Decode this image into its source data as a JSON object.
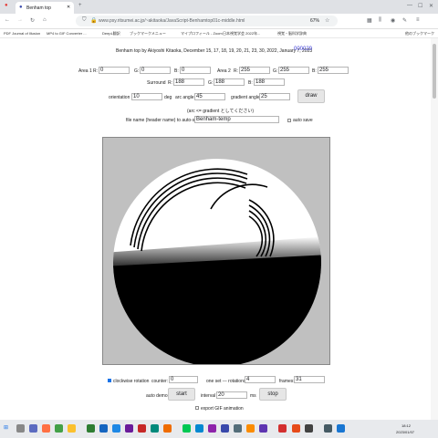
{
  "browser": {
    "tab_title": "Benham top",
    "url": "www.psy.ritsumei.ac.jp/~akitaoka/JavaScript-Benhamtop01c-middle.html",
    "zoom": "67%",
    "bookmarks": [
      "PDF Journal of Illusion",
      "MP4 to GIF Converter ...",
      "DeepL翻訳",
      "ブックマークメニュー",
      "マイプロフィール - Zoom",
      "日本視覚学会 2022年...",
      "視覚・脳科学辞典",
      "他のブックマーク"
    ]
  },
  "page": {
    "header": "Benham top by Akiyoshi Kitaoka, December 15, 17, 18, 19, 20, 21, 23, 30, 2022, January 7, 2023",
    "counter_badge": "000029",
    "area1": {
      "label": "Area 1",
      "r_label": "R:",
      "g_label": "G:",
      "b_label": "B:",
      "r": "0",
      "g": "0",
      "b": "0"
    },
    "area2": {
      "label": "Area 2",
      "r_label": "R:",
      "g_label": "G:",
      "b_label": "B:",
      "r": "255",
      "g": "255",
      "b": "255"
    },
    "surround": {
      "label": "Surround",
      "r_label": "R:",
      "g_label": "G:",
      "b_label": "B:",
      "r": "188",
      "g": "188",
      "b": "188"
    },
    "orientation_label": "orientation",
    "orientation": "10",
    "orientation_unit": "deg",
    "arc_angle_label": "arc angle",
    "arc_angle": "45",
    "gradient_angle_label": "gradient angle",
    "gradient_angle": "25",
    "draw_label": "draw",
    "note": "(arc <= gradient としてください)",
    "filename_label": "file name (header name) to auto-save",
    "filename": "Benham-temp",
    "auto_save_label": "auto save",
    "clockwise_label": "clockwise rotation",
    "counter_label": "counter:",
    "counter": "0",
    "rotations_label": "one set --- rotations:",
    "rotations": "4",
    "frames_label": "frames:",
    "frames": "31",
    "auto_demo_label": "auto demo:",
    "start_label": "start",
    "interval_label": "interval",
    "interval": "20",
    "interval_unit": "ms",
    "stop_label": "stop",
    "export_gif_label": "export GIF animation"
  },
  "taskbar": {
    "time": "18:12",
    "date": "2023/01/07"
  },
  "colors": {
    "counter_badge": "#3b3bd6",
    "surround": "#bcbcbc"
  }
}
